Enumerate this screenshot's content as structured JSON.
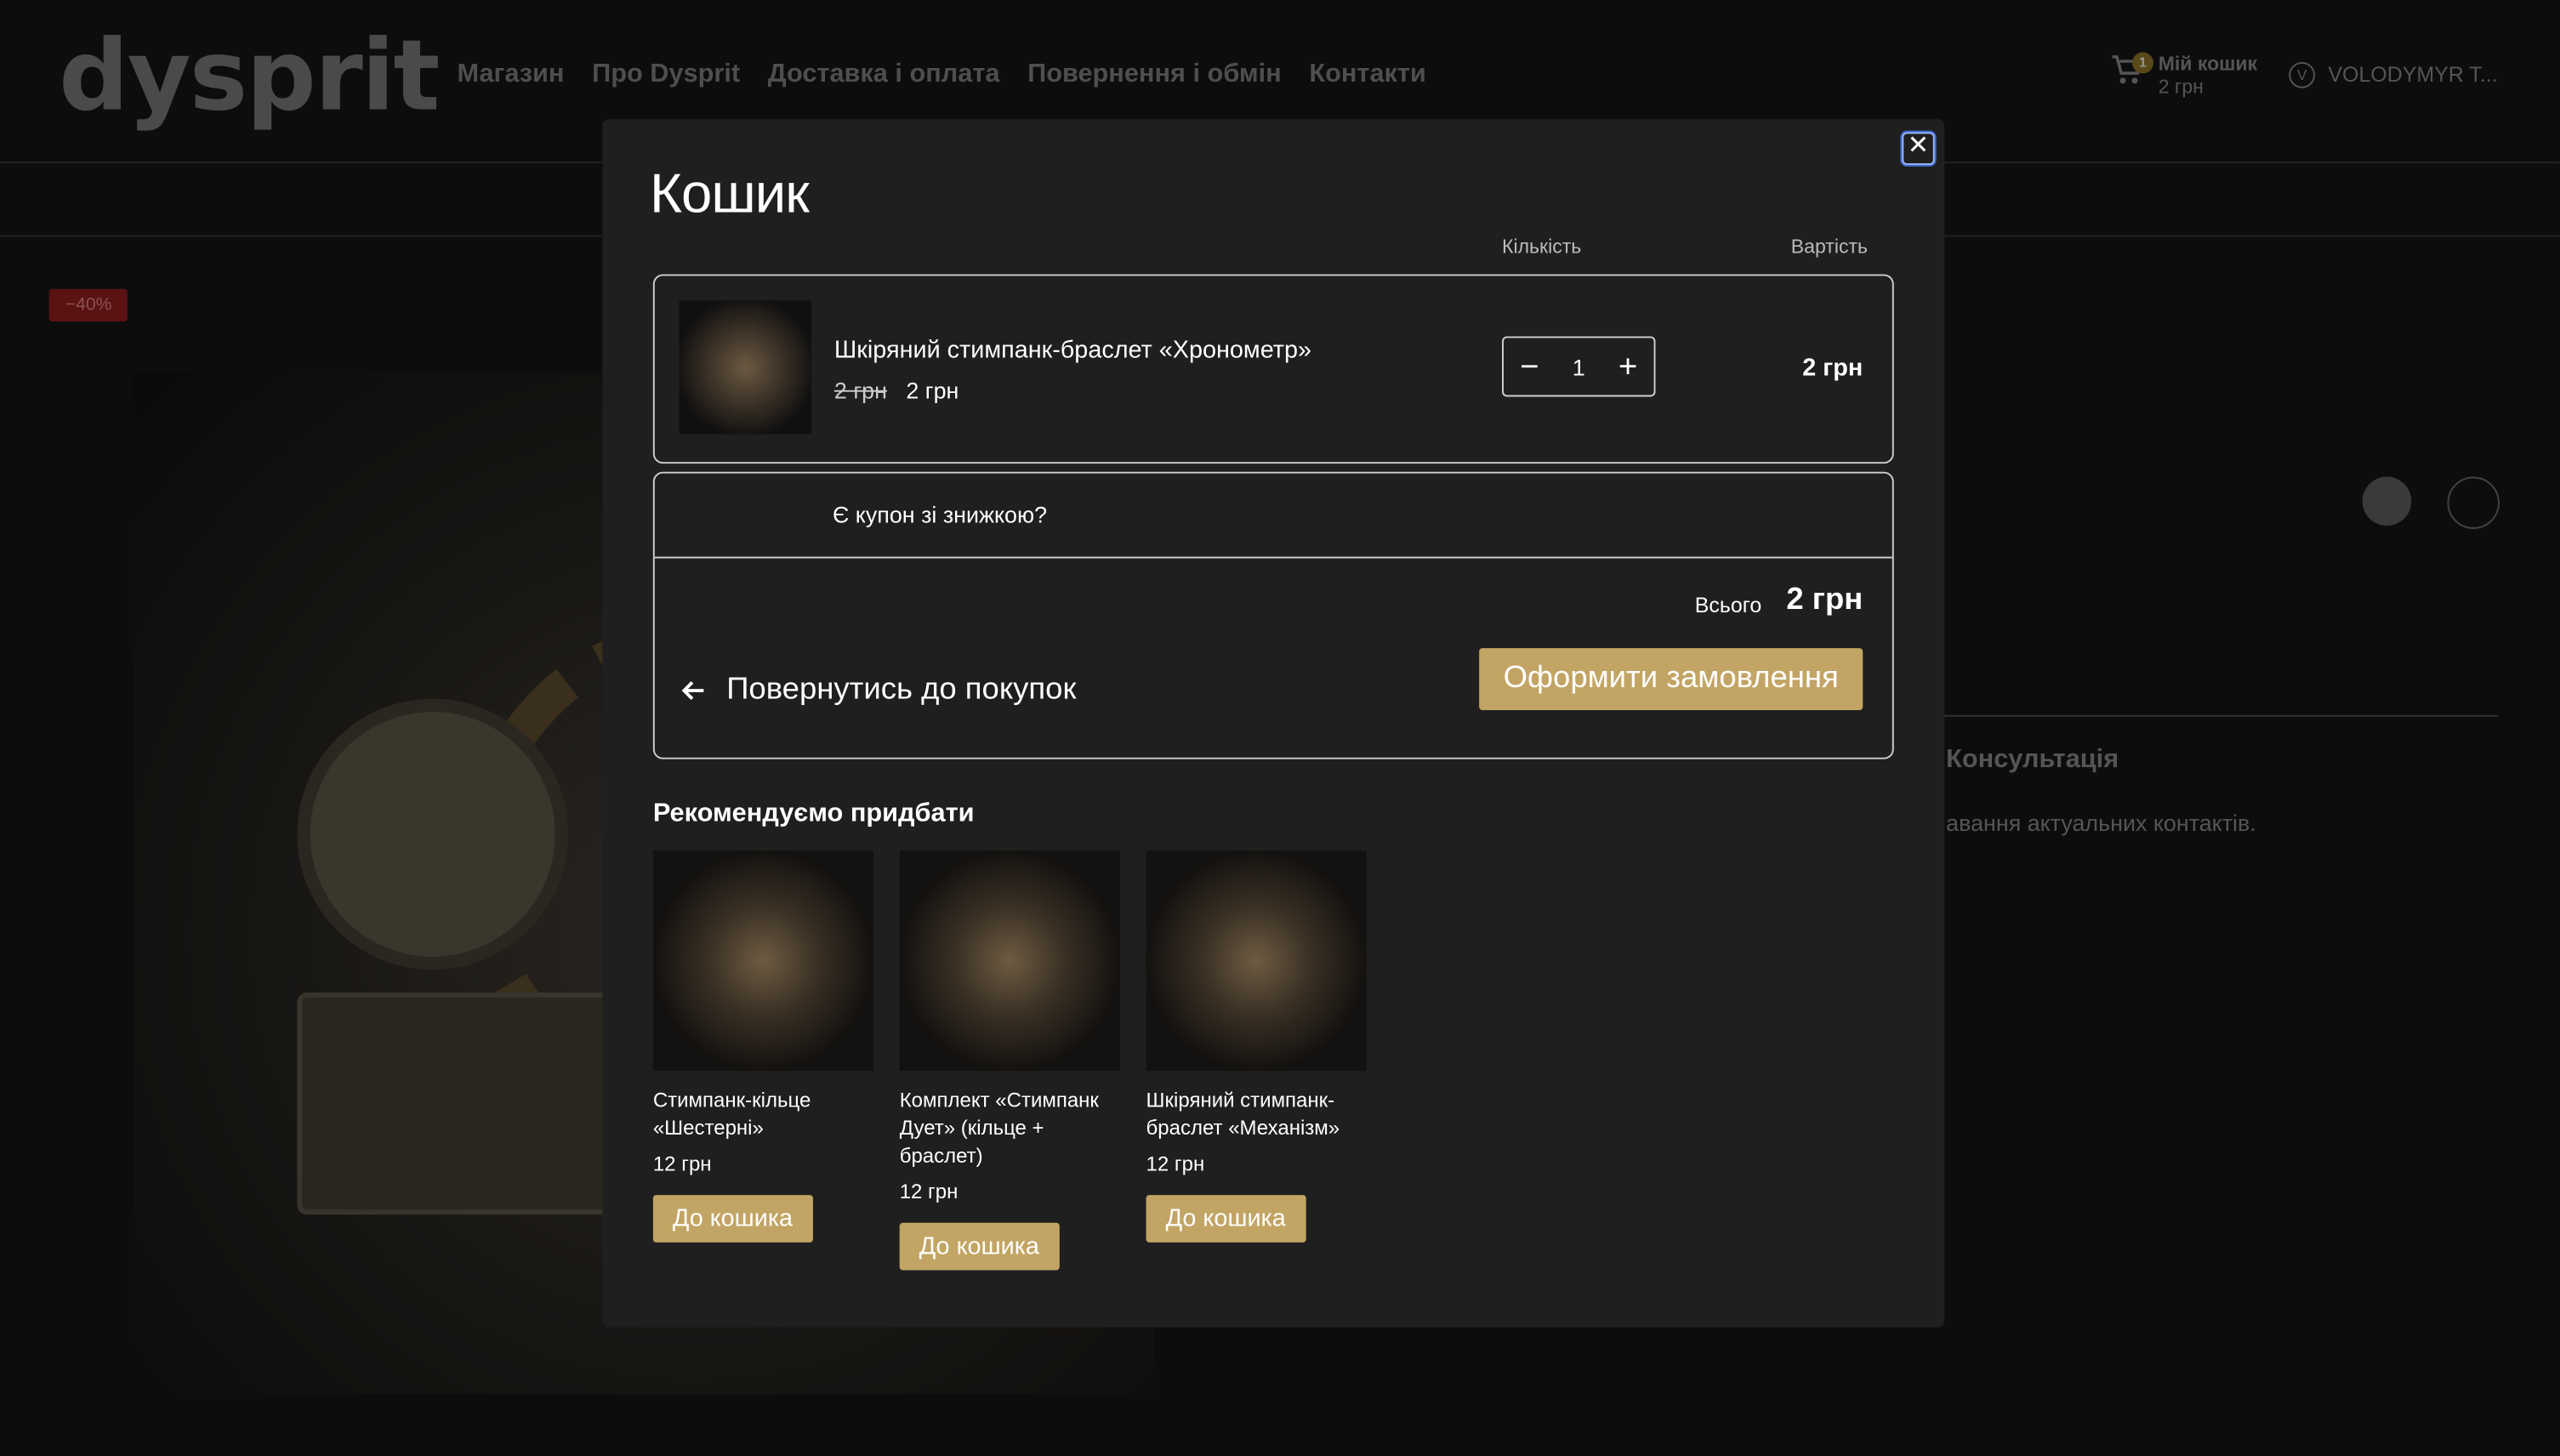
{
  "site": {
    "logo": "dysprit",
    "nav": [
      "Магазин",
      "Про Dysprit",
      "Доставка і оплата",
      "Повернення і обмін",
      "Контакти"
    ],
    "cart_label": "Мій кошик",
    "cart_amount": "2 грн",
    "cart_count": "1",
    "user_initial": "V",
    "user_name": "VOLODYMYR T...",
    "sale_badge": "−40%",
    "consult_title": "Консультація",
    "consult_text": "авання актуальних контактів."
  },
  "modal": {
    "title": "Кошик",
    "col_qty": "Кількість",
    "col_price": "Вартість",
    "item": {
      "name": "Шкіряний стимпанк-браслет «Хронометр»",
      "old_price": "2 грн",
      "price": "2 грн",
      "qty": "1",
      "total": "2 грн"
    },
    "coupon": "Є купон зі знижкою?",
    "total_label": "Всього",
    "total_value": "2 грн",
    "back": "Повернутись до покупок",
    "checkout": "Оформити замовлення",
    "rec_title": "Рекомендуємо придбати",
    "recs": [
      {
        "name": "Стимпанк-кільце «Шестерні»",
        "price": "12 грн",
        "btn": "До кошика"
      },
      {
        "name": "Комплект «Стимпанк Дует» (кільце + браслет)",
        "price": "12 грн",
        "btn": "До кошика"
      },
      {
        "name": "Шкіряний стимпанк-браслет «Механізм»",
        "price": "12 грн",
        "btn": "До кошика"
      }
    ]
  }
}
